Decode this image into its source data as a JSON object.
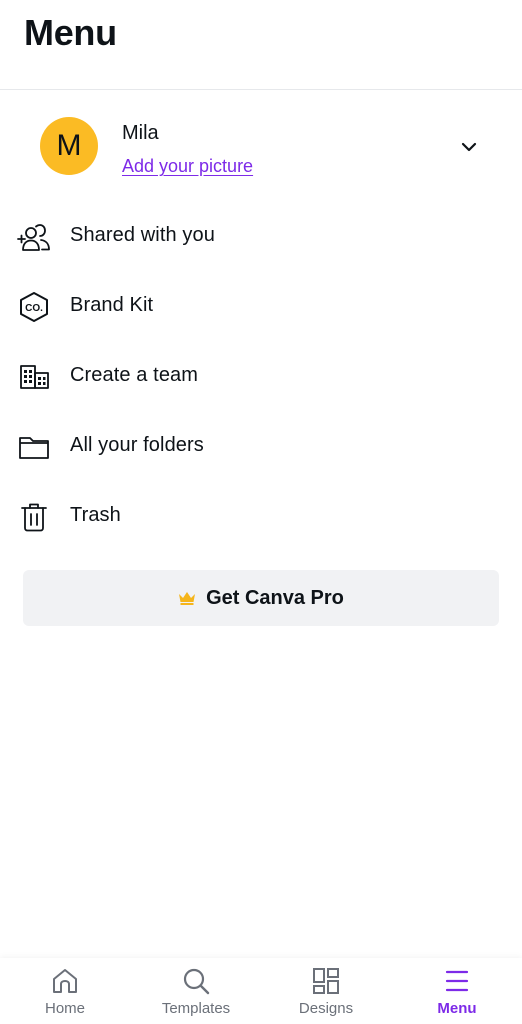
{
  "header": {
    "title": "Menu"
  },
  "profile": {
    "avatar_initial": "M",
    "name": "Mila",
    "add_picture_label": "Add your picture"
  },
  "menu": {
    "items": [
      {
        "label": "Shared with you",
        "icon": "shared-people-icon"
      },
      {
        "label": "Brand Kit",
        "icon": "brand-kit-icon"
      },
      {
        "label": "Create a team",
        "icon": "team-building-icon"
      },
      {
        "label": "All your folders",
        "icon": "folder-icon"
      },
      {
        "label": "Trash",
        "icon": "trash-icon"
      }
    ]
  },
  "pro": {
    "label": "Get Canva Pro",
    "icon": "crown-icon"
  },
  "bottom_nav": {
    "items": [
      {
        "label": "Home",
        "icon": "home-icon"
      },
      {
        "label": "Templates",
        "icon": "search-icon"
      },
      {
        "label": "Designs",
        "icon": "designs-grid-icon"
      },
      {
        "label": "Menu",
        "icon": "hamburger-icon"
      }
    ],
    "active": "Menu"
  },
  "colors": {
    "accent": "#7d2ae8",
    "avatar_bg": "#fbbb24",
    "crown": "#f5b51b",
    "button_bg": "#f1f2f4",
    "text": "#0e1318",
    "muted": "#6b7079"
  }
}
